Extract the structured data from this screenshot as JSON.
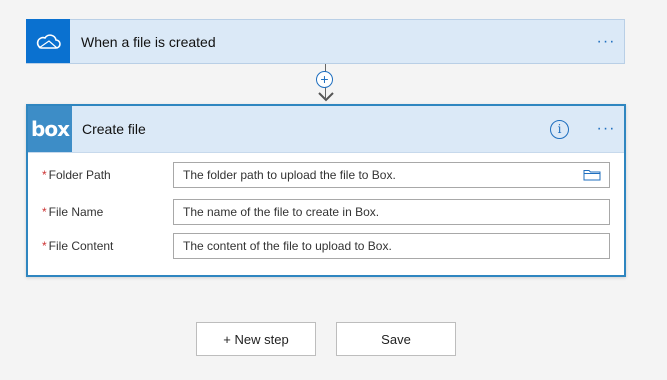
{
  "trigger": {
    "title": "When a file is created",
    "icon": "onedrive-cloud-icon",
    "more_label": "···"
  },
  "connector": {
    "add_label": "+"
  },
  "action": {
    "title": "Create file",
    "logo_text": "box",
    "info_label": "i",
    "more_label": "···",
    "required_marker": "*",
    "fields": [
      {
        "label": "Folder Path",
        "placeholder": "The folder path to upload the file to Box."
      },
      {
        "label": "File Name",
        "placeholder": "The name of the file to create in Box."
      },
      {
        "label": "File Content",
        "placeholder": "The content of the file to upload to Box."
      }
    ]
  },
  "buttons": {
    "new_step": "+ New step",
    "save": "Save"
  },
  "colors": {
    "onedrive_blue": "#0a71d0",
    "box_blue": "#3d8dc7",
    "accent": "#1f6fbf",
    "header_bg": "#dbe9f7",
    "required": "#cc3333"
  }
}
